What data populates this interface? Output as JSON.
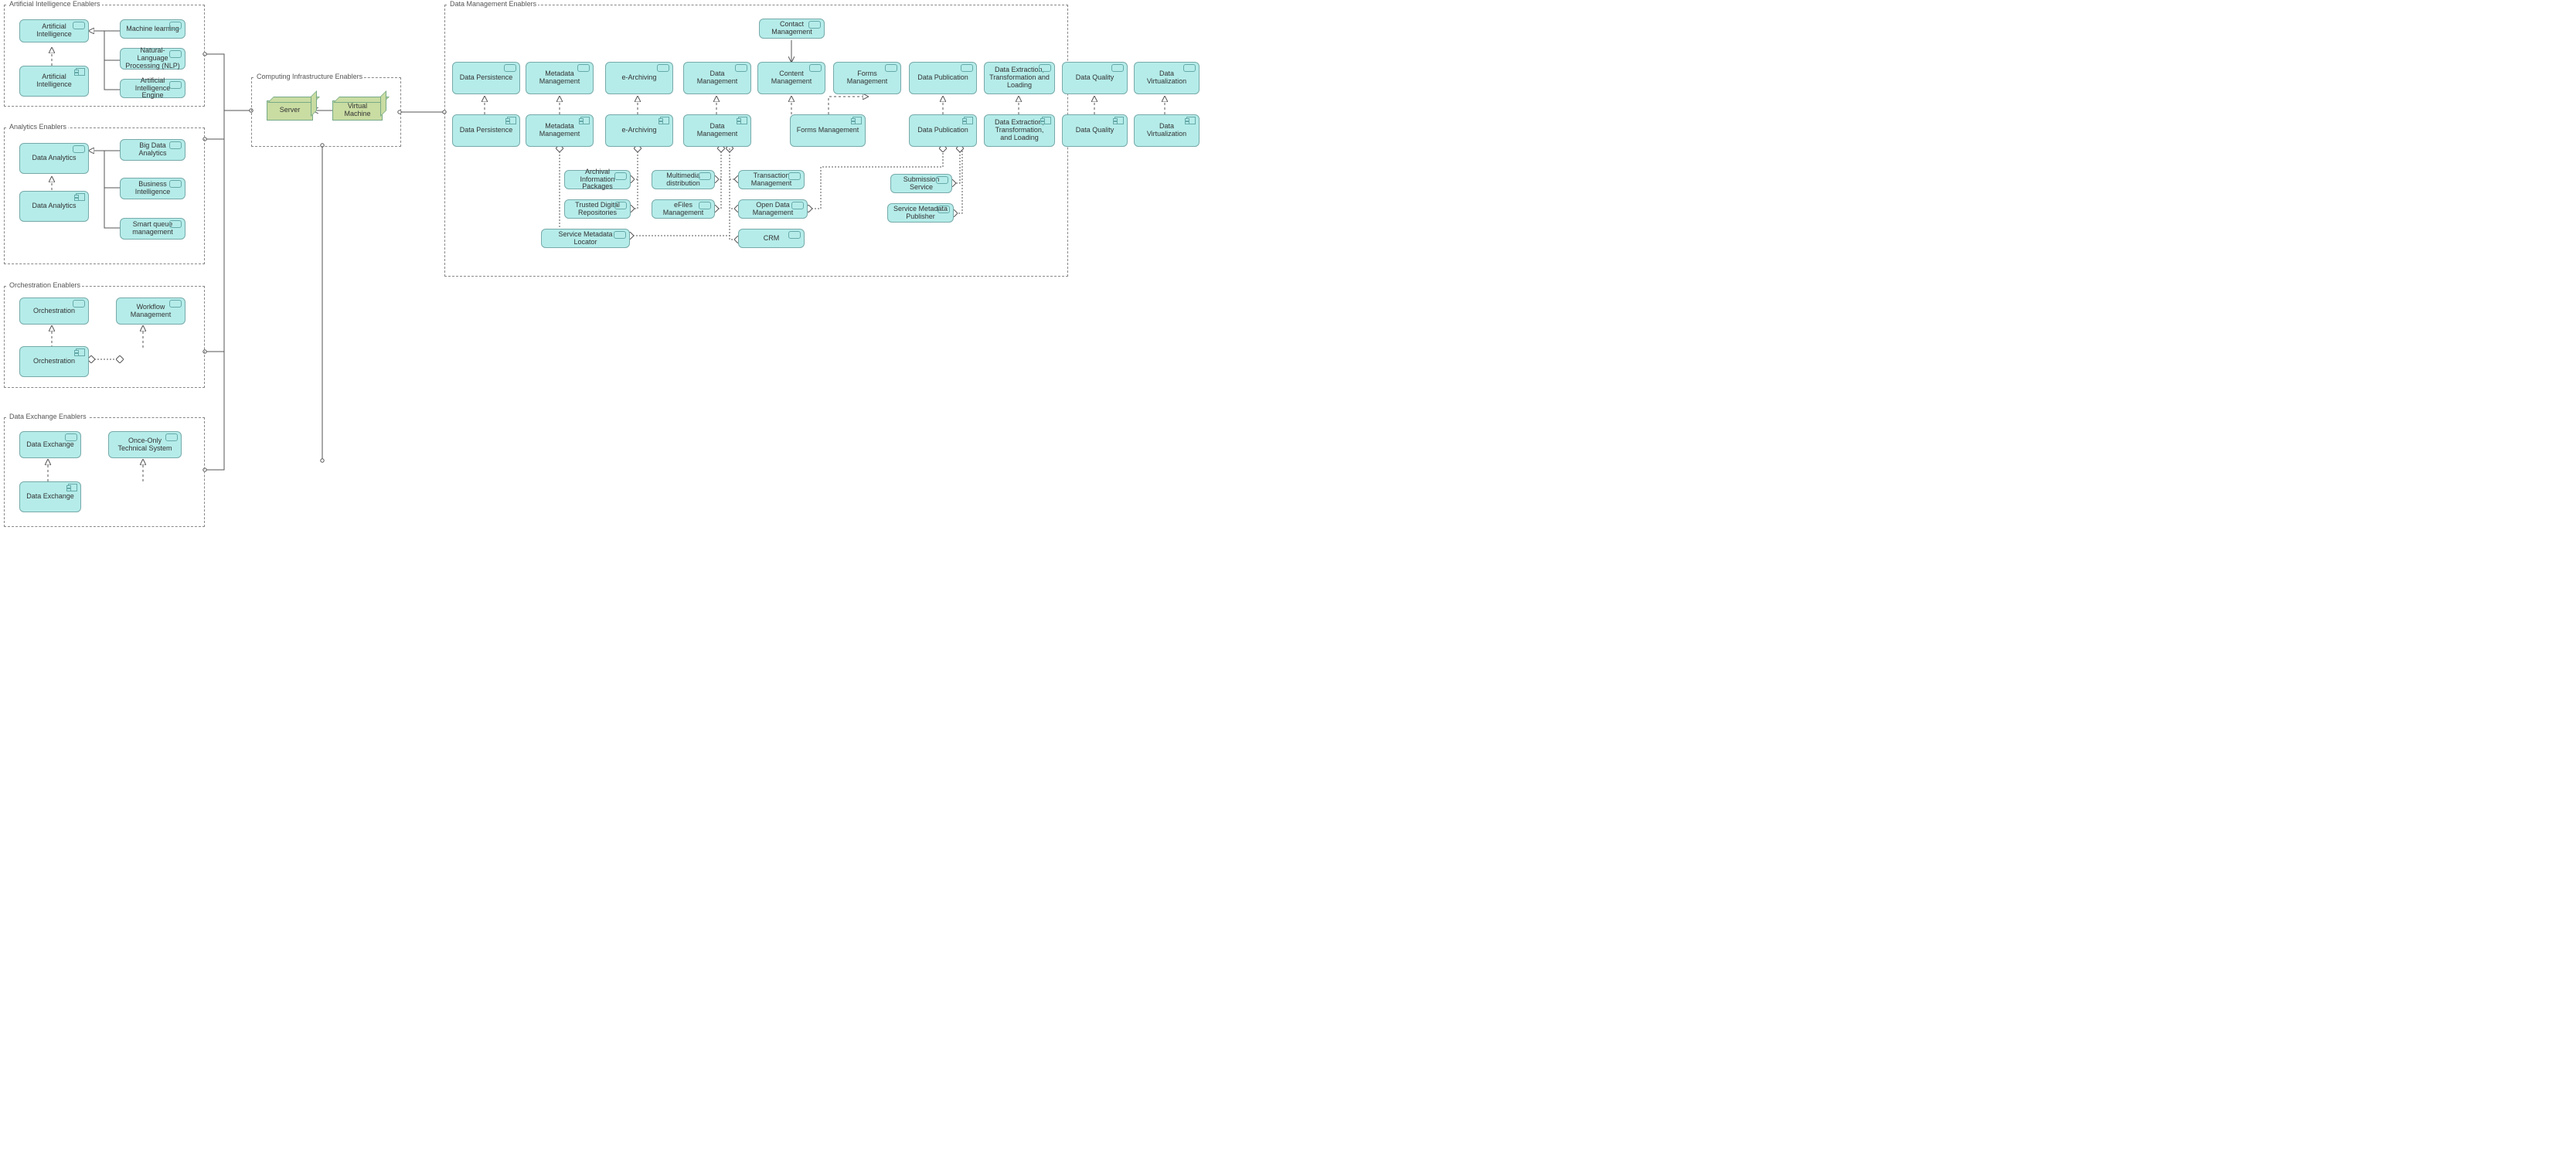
{
  "groups": {
    "ai": {
      "title": "Artificial Intelligence Enablers"
    },
    "analytics": {
      "title": "Analytics Enablers"
    },
    "orch": {
      "title": "Orchestration Enablers"
    },
    "dex": {
      "title": "Data Exchange Enablers"
    },
    "infra": {
      "title": "Computing Infrastructure Enablers"
    },
    "dm": {
      "title": "Data Management Enablers"
    }
  },
  "boxes": {
    "ai_svc": "Artificial Intelligence",
    "ai_comp": "Artificial Intelligence",
    "ml": "Machine learning",
    "nlp": "Natural-Language Processing (NLP)",
    "aie": "Artificial Intelligence Engine",
    "an_svc": "Data Analytics",
    "an_comp": "Data Analytics",
    "bda": "Big Data Analytics",
    "bi": "Business Intelligence",
    "sqm": "Smart queue management",
    "or_svc": "Orchestration",
    "or_comp": "Orchestration",
    "wfm": "Workflow Management",
    "dx_svc": "Data Exchange",
    "dx_comp": "Data Exchange",
    "oots": "Once-Only Technical System",
    "server": "Server",
    "vm": "Virtual Machine",
    "cm": "Contact Management",
    "dp_s": "Data Persistence",
    "dp_c": "Data Persistence",
    "mm_s": "Metadata Management",
    "mm_c": "Metadata Management",
    "ea_s": "e-Archiving",
    "ea_c": "e-Archiving",
    "dmg_s": "Data Management",
    "dmg_c": "Data Management",
    "cnt_s": "Content Management",
    "fm_s": "Forms Management",
    "fm_c": "Forms Management",
    "dpub_s": "Data Publication",
    "dpub_c": "Data Publication",
    "detl_s": "Data Extraction, Transformation and Loading",
    "detl_c": "Data Extraction, Transformation, and Loading",
    "dq_s": "Data Quality",
    "dq_c": "Data Quality",
    "dv_s": "Data Virtualization",
    "dv_c": "Data Virtualization",
    "aip": "Archival Information Packages",
    "mmd": "Multimedia distribution",
    "txm": "Transaction Management",
    "tdr": "Trusted Digital Repositories",
    "efm": "eFiles Management",
    "odm": "Open Data Management",
    "sml": "Service Metadata Locator",
    "crm": "CRM",
    "sub": "Submission Service",
    "smp": "Service Metadata Publisher"
  }
}
